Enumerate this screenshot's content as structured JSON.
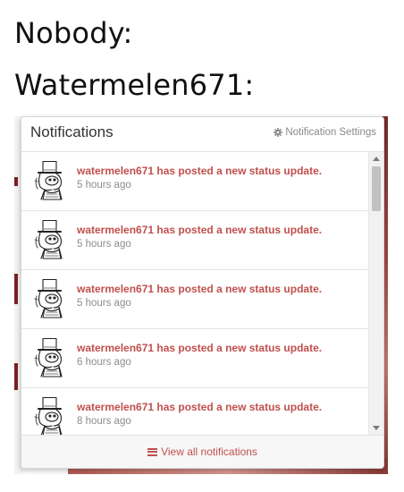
{
  "captions": {
    "line1": "Nobody:",
    "line2": "Watermelen671:"
  },
  "popup": {
    "title": "Notifications",
    "settings_label": "Notification Settings",
    "settings_icon": "gear-icon",
    "footer_icon": "list-icon",
    "footer_label": "View all notifications",
    "avatar_icon": "top-hat-character-avatar",
    "accent_color": "#c0504d",
    "items": [
      {
        "message": "watermelen671 has posted a new status update.",
        "time": "5 hours ago"
      },
      {
        "message": "watermelen671 has posted a new status update.",
        "time": "5 hours ago"
      },
      {
        "message": "watermelen671 has posted a new status update.",
        "time": "5 hours ago"
      },
      {
        "message": "watermelen671 has posted a new status update.",
        "time": "6 hours ago"
      },
      {
        "message": "watermelen671 has posted a new status update.",
        "time": "8 hours ago"
      }
    ]
  }
}
